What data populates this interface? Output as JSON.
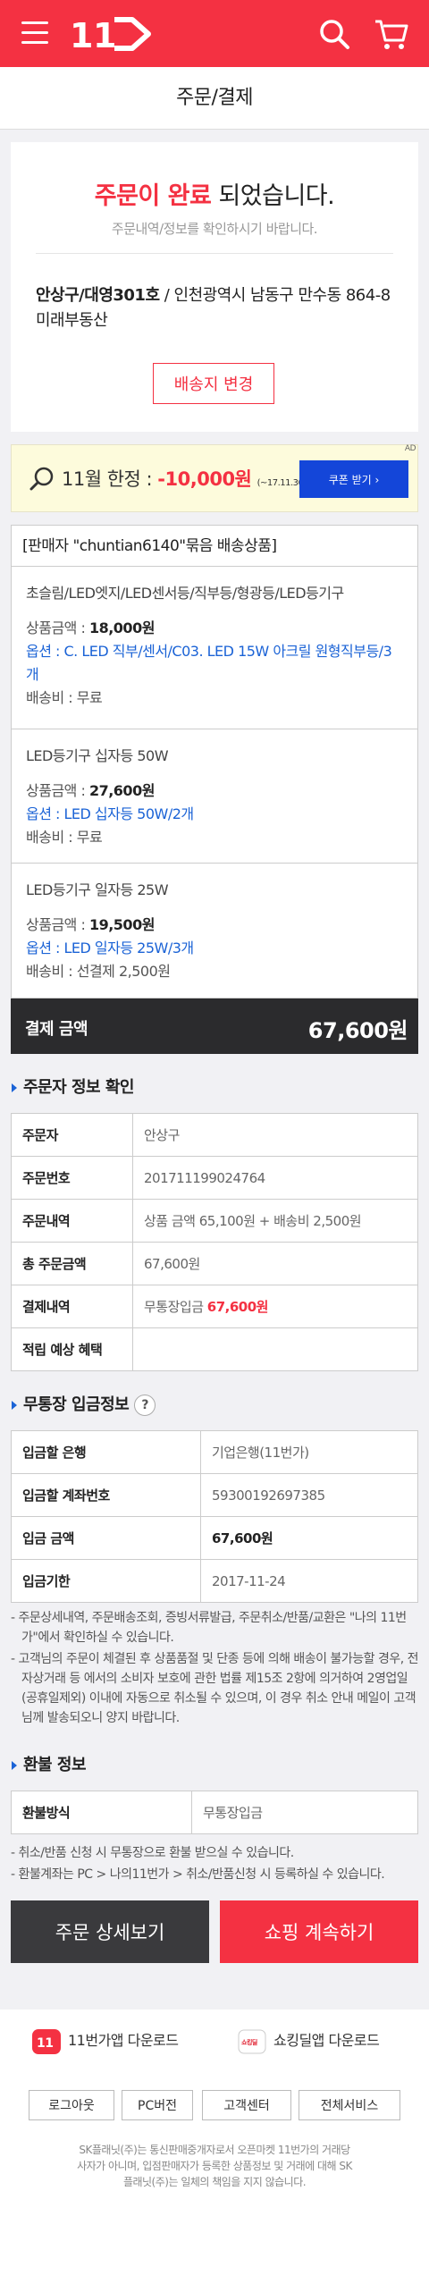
{
  "header": {
    "logo_text": "11"
  },
  "page_title": "주문/결제",
  "completion": {
    "title_red": "주문이 완료",
    "title_rest": " 되었습니다.",
    "subtitle": "주문내역/정보를 확인하시기 바랍니다.",
    "address_bold": "안상구/대영301호",
    "address_rest": " / 인천광역시 남동구 만수동 864-8 미래부동산",
    "change_button": "배송지 변경"
  },
  "coupon": {
    "prefix": "11월 한정 : ",
    "amount": "-10,000원",
    "period": "(~17.11.30)",
    "button": "쿠폰 받기",
    "ad_mark": "AD"
  },
  "seller_bundle": {
    "header": "[판매자 \"chuntian6140\"묶음 배송상품]",
    "items": [
      {
        "name": "초슬림/LED엣지/LED센서등/직부등/형광등/LED등기구",
        "price_label": "상품금액 : ",
        "price": "18,000원",
        "option": "옵션 : C. LED 직부/센서/C03. LED 15W 아크릴 원형직부등/3개",
        "shipping": "배송비 : 무료"
      },
      {
        "name": "LED등기구 십자등 50W",
        "price_label": "상품금액 : ",
        "price": "27,600원",
        "option": "옵션 : LED 십자등 50W/2개",
        "shipping": "배송비 : 무료"
      },
      {
        "name": "LED등기구 일자등 25W",
        "price_label": "상품금액 : ",
        "price": "19,500원",
        "option": "옵션 : LED 일자등 25W/3개",
        "shipping": "배송비 : 선결제 2,500원"
      }
    ]
  },
  "payment_total": {
    "label": "결제 금액",
    "value": "67,600원"
  },
  "orderer_section": {
    "title": "주문자 정보 확인",
    "rows": [
      {
        "label": "주문자",
        "value": "안상구"
      },
      {
        "label": "주문번호",
        "value": "201711199024764"
      },
      {
        "label": "주문내역",
        "value": "상품 금액 65,100원 + 배송비 2,500원"
      },
      {
        "label": "총 주문금액",
        "value": "67,600원"
      },
      {
        "label": "결제내역",
        "value": "무통장입금 ",
        "value_red": "67,600원"
      },
      {
        "label": "적립 예상 혜택",
        "value": ""
      }
    ]
  },
  "deposit_section": {
    "title": "무통장 입금정보",
    "help": "?",
    "rows": [
      {
        "label": "입금할 은행",
        "value": "기업은행(11번가)"
      },
      {
        "label": "입금할 계좌번호",
        "value": "59300192697385"
      },
      {
        "label": "입금 금액",
        "value": "67,600원"
      },
      {
        "label": "입금기한",
        "value": "2017-11-24"
      }
    ],
    "notes": [
      "- 주문상세내역, 주문배송조회, 증빙서류발급, 주문취소/반품/교환은 \"나의 11번가\"에서 확인하실 수 있습니다.",
      "- 고객님의 주문이 체결된 후 상품품절 및 단종 등에 의해 배송이 불가능할 경우, 전자상거래 등 에서의 소비자 보호에 관한 법률 제15조 2항에 의거하여 2영업일(공휴일제외) 이내에 자동으로 취소될 수 있으며, 이 경우 취소 안내 메일이 고객님께 발송되오니 양지 바랍니다."
    ]
  },
  "refund_section": {
    "title": "환불 정보",
    "rows": [
      {
        "label": "환불방식",
        "value": "무통장입금"
      }
    ],
    "notes": [
      "- 취소/반품 신청 시 무통장으로 환불 받으실 수 있습니다.",
      "- 환불계좌는 PC > 나의11번가 > 취소/반품신청 시 등록하실 수 있습니다."
    ]
  },
  "actions": {
    "detail": "주문 상세보기",
    "continue": "쇼핑 계속하기"
  },
  "footer": {
    "app1_badge": "11",
    "app1": "11번가앱 다운로드",
    "app2_badge": "쇼킹딜",
    "app2": "쇼킹딜앱 다운로드",
    "links": [
      "로그아웃",
      "PC버전",
      "고객센터",
      "전체서비스"
    ],
    "legal": "SK플래닛(주)는 통신판매중개자로서 오픈마켓 11번가의 거래당사자가 아니며, 입점판매자가 등록한 상품정보 및 거래에 대해 SK플래닛(주)는 일체의 책임을 지지 않습니다."
  },
  "colors": {
    "brand": "#f43142",
    "blue": "#1446d9",
    "dark": "#2b2b2d"
  }
}
